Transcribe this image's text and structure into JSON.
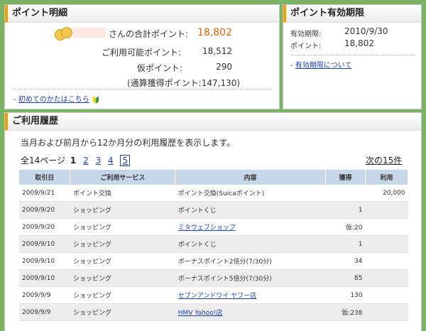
{
  "detail": {
    "title": "ポイント明細",
    "name_suffix": "さんの合計ポイント:",
    "total": "18,802",
    "usable_label": "ご利用可能ポイント:",
    "usable": "18,512",
    "provisional_label": "仮ポイント:",
    "provisional": "290",
    "accumulated": "(通算獲得ポイント:147,130)",
    "first_time_link": "初めてのかたはこちら"
  },
  "expire": {
    "title": "ポイント有効期限",
    "date_label": "有効期限:",
    "date": "2010/9/30",
    "points_label": "ポイント:",
    "points": "18,802",
    "about_link": "有効期限について"
  },
  "history": {
    "title": "ご利用履歴",
    "description": "当月および前月から12か月分の利用履歴を表示します。",
    "total_pages": "全14ページ",
    "pages": [
      "1",
      "2",
      "3",
      "4",
      "5"
    ],
    "next": "次の15件",
    "columns": [
      "取引日",
      "ご利用サービス",
      "内容",
      "獲得",
      "利用"
    ],
    "rows": [
      {
        "date": "2009/9/21",
        "service": "ポイント交換",
        "content": "ポイント交換(Suicaポイント)",
        "earned": "",
        "used": "20,000",
        "link": false
      },
      {
        "date": "2009/9/20",
        "service": "ショッピング",
        "content": "ポイントくじ",
        "earned": "1",
        "used": "",
        "link": false
      },
      {
        "date": "2009/9/20",
        "service": "ショッピング",
        "content": "ミタウェブショップ",
        "earned": "仮:20",
        "used": "",
        "link": true
      },
      {
        "date": "2009/9/10",
        "service": "ショッピング",
        "content": "ポイントくじ",
        "earned": "1",
        "used": "",
        "link": false
      },
      {
        "date": "2009/9/10",
        "service": "ショッピング",
        "content": "ボーナスポイント2倍分(7/30分)",
        "earned": "34",
        "used": "",
        "link": false
      },
      {
        "date": "2009/9/10",
        "service": "ショッピング",
        "content": "ボーナスポイント5倍分(7/30分)",
        "earned": "85",
        "used": "",
        "link": false
      },
      {
        "date": "2009/9/9",
        "service": "ショッピング",
        "content": "セブンアンドワイ ヤフー店",
        "earned": "130",
        "used": "",
        "link": true
      },
      {
        "date": "2009/9/9",
        "service": "ショッピング",
        "content": "HMV Yahoo!店",
        "earned": "仮:238",
        "used": "",
        "link": true
      }
    ]
  }
}
